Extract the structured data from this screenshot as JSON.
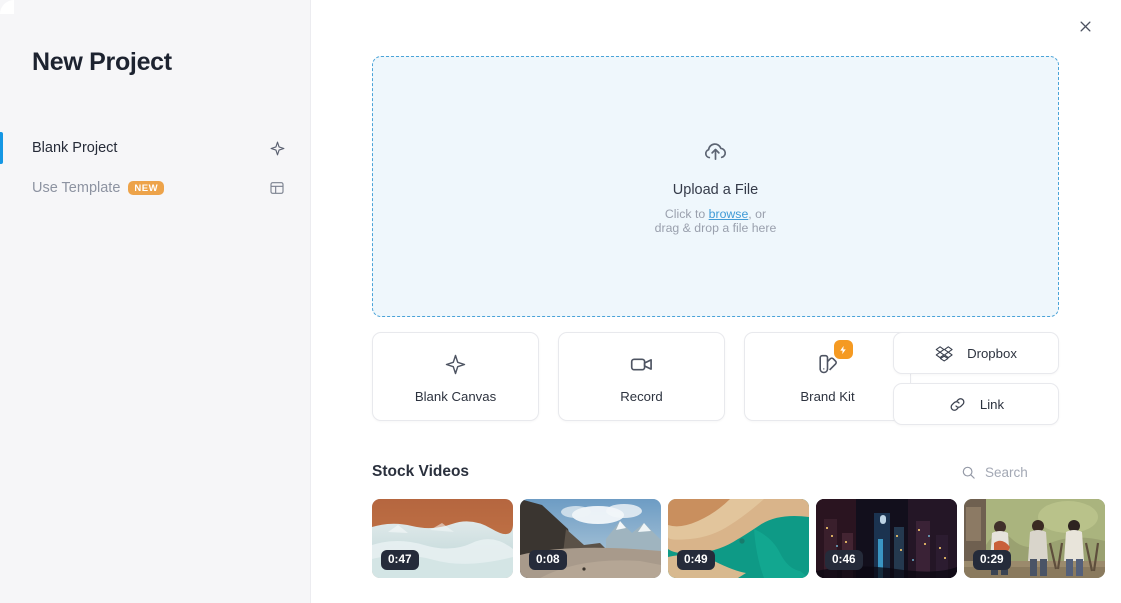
{
  "sidebar": {
    "title": "New Project",
    "items": [
      {
        "label": "Blank Project",
        "icon": "sparkle-icon",
        "active": true,
        "badge": null
      },
      {
        "label": "Use Template",
        "icon": "layout-template-icon",
        "active": false,
        "badge": "NEW"
      }
    ]
  },
  "main": {
    "close_label": "✕",
    "dropzone": {
      "icon": "cloud-upload-icon",
      "title": "Upload a File",
      "sub_prefix": "Click to ",
      "link": "browse",
      "sub_suffix": ", or",
      "sub_line2": "drag & drop a file here",
      "border_color": "#4aa3d8",
      "fill_color": "#eff7fc"
    },
    "cards": [
      {
        "label": "Blank Canvas",
        "icon": "sparkle-icon",
        "badge": null
      },
      {
        "label": "Record",
        "icon": "video-camera-icon",
        "badge": null
      },
      {
        "label": "Brand Kit",
        "icon": "brand-palette-icon",
        "badge": "lightning-bolt-icon"
      }
    ],
    "side_buttons": [
      {
        "label": "Dropbox",
        "icon": "dropbox-icon"
      },
      {
        "label": "Link",
        "icon": "link-icon"
      }
    ],
    "stock": {
      "title": "Stock Videos",
      "search_placeholder": "Search",
      "search_value": "",
      "videos": [
        {
          "duration": "0:47",
          "scene": "glacier-ice-waves"
        },
        {
          "duration": "0:08",
          "scene": "mountain-valley-road"
        },
        {
          "duration": "0:49",
          "scene": "aerial-turquoise-coast"
        },
        {
          "duration": "0:46",
          "scene": "city-skyline-night"
        },
        {
          "duration": "0:29",
          "scene": "people-porch-conversation"
        }
      ]
    }
  },
  "theme": {
    "accent_blue": "#1597e4",
    "badge_orange": "#eda34a",
    "sidebar_bg": "#f6f6f8",
    "duration_badge_bg": "#252b3a"
  }
}
